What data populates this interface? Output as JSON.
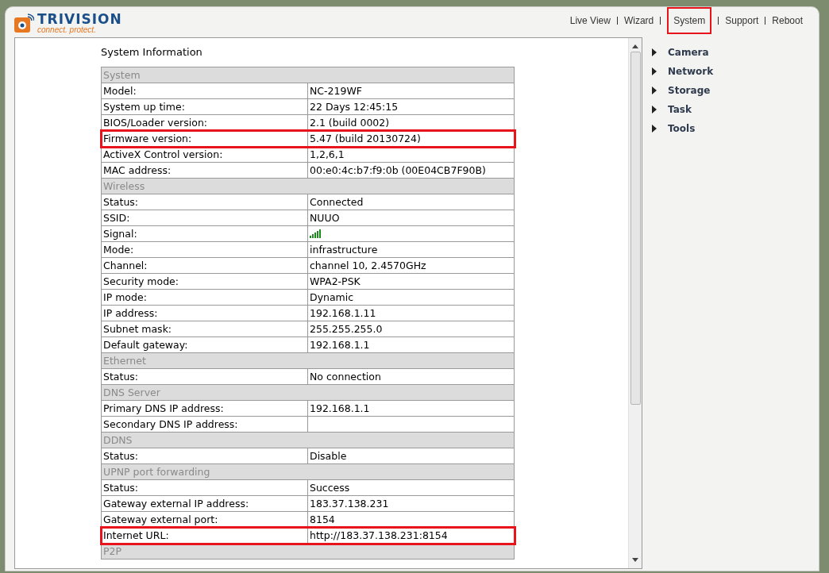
{
  "logo": {
    "name": "TRIVISION",
    "tagline": "connect. protect."
  },
  "nav": [
    {
      "label": "Live View",
      "highlighted": false
    },
    {
      "label": "Wizard",
      "highlighted": false
    },
    {
      "label": "System",
      "highlighted": true
    },
    {
      "label": "Support",
      "highlighted": false
    },
    {
      "label": "Reboot",
      "highlighted": false
    }
  ],
  "title": "System Information",
  "rows": [
    {
      "kind": "section",
      "label": "System"
    },
    {
      "kind": "field",
      "label": "Model:",
      "value": "NC-219WF",
      "highlighted": false
    },
    {
      "kind": "field",
      "label": "System up time:",
      "value": "22 Days 12:45:15",
      "highlighted": false
    },
    {
      "kind": "field",
      "label": "BIOS/Loader version:",
      "value": "2.1 (build 0002)",
      "highlighted": false
    },
    {
      "kind": "field",
      "label": "Firmware version:",
      "value": "5.47 (build 20130724)",
      "highlighted": true
    },
    {
      "kind": "field",
      "label": "ActiveX Control version:",
      "value": "1,2,6,1",
      "highlighted": false
    },
    {
      "kind": "field",
      "label": "MAC address:",
      "value": "00:e0:4c:b7:f9:0b (00E04CB7F90B)",
      "highlighted": false
    },
    {
      "kind": "section",
      "label": "Wireless"
    },
    {
      "kind": "field",
      "label": "Status:",
      "value": "Connected",
      "highlighted": false
    },
    {
      "kind": "field",
      "label": "SSID:",
      "value": "NUUO",
      "highlighted": false
    },
    {
      "kind": "signal",
      "label": "Signal:",
      "highlighted": false
    },
    {
      "kind": "field",
      "label": "Mode:",
      "value": "infrastructure",
      "highlighted": false
    },
    {
      "kind": "field",
      "label": "Channel:",
      "value": "channel 10, 2.4570GHz",
      "highlighted": false
    },
    {
      "kind": "field",
      "label": "Security mode:",
      "value": "WPA2-PSK",
      "highlighted": false
    },
    {
      "kind": "field",
      "label": "IP mode:",
      "value": "Dynamic",
      "highlighted": false
    },
    {
      "kind": "field",
      "label": "IP address:",
      "value": "192.168.1.11",
      "highlighted": false
    },
    {
      "kind": "field",
      "label": "Subnet mask:",
      "value": "255.255.255.0",
      "highlighted": false
    },
    {
      "kind": "field",
      "label": "Default gateway:",
      "value": "192.168.1.1",
      "highlighted": false
    },
    {
      "kind": "section",
      "label": "Ethernet"
    },
    {
      "kind": "field",
      "label": "Status:",
      "value": "No connection",
      "highlighted": false
    },
    {
      "kind": "section",
      "label": "DNS Server"
    },
    {
      "kind": "field",
      "label": "Primary DNS IP address:",
      "value": "192.168.1.1",
      "highlighted": false
    },
    {
      "kind": "field",
      "label": "Secondary DNS IP address:",
      "highlighted": false
    },
    {
      "kind": "section",
      "label": "DDNS"
    },
    {
      "kind": "field",
      "label": "Status:",
      "value": "Disable",
      "highlighted": false
    },
    {
      "kind": "section",
      "label": "UPNP port forwarding"
    },
    {
      "kind": "field",
      "label": "Status:",
      "value": "Success",
      "highlighted": false
    },
    {
      "kind": "field",
      "label": "Gateway external IP address:",
      "value": "183.37.138.231",
      "highlighted": false
    },
    {
      "kind": "field",
      "label": "Gateway external port:",
      "value": "8154",
      "highlighted": false
    },
    {
      "kind": "field",
      "label": "Internet URL:",
      "value": "http://183.37.138.231:8154",
      "highlighted": true
    },
    {
      "kind": "section",
      "label": "P2P"
    }
  ],
  "menu": [
    "Camera",
    "Network",
    "Storage",
    "Task",
    "Tools"
  ]
}
